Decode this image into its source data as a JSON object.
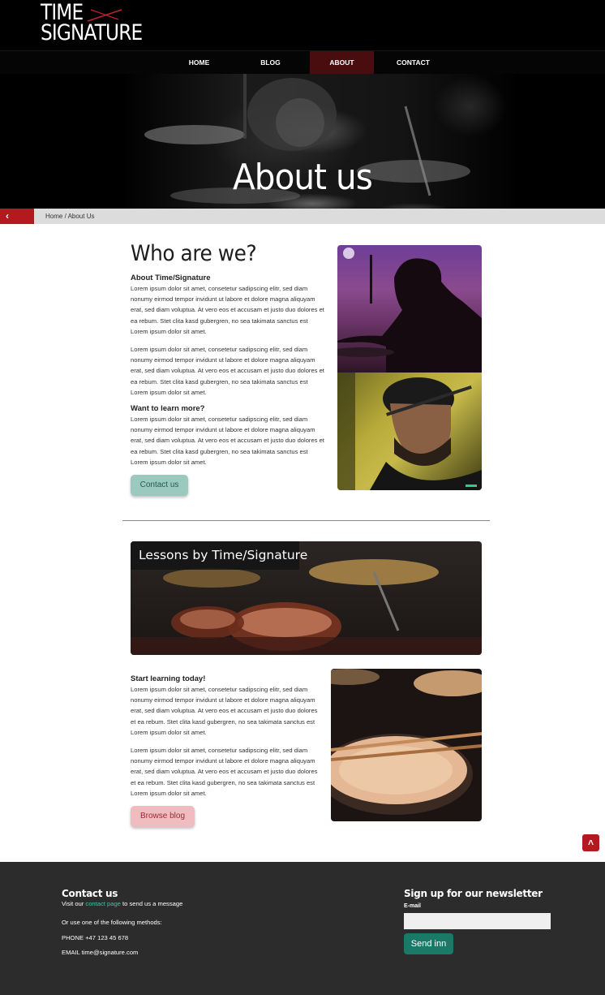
{
  "brand": {
    "line1": "TIME",
    "line2": "SIGNATURE"
  },
  "nav": [
    {
      "label": "HOME"
    },
    {
      "label": "BLOG"
    },
    {
      "label": "ABOUT"
    },
    {
      "label": "CONTACT"
    }
  ],
  "nav_active": "ABOUT",
  "hero": {
    "title": "About us"
  },
  "breadcrumb": {
    "back_icon": "chevron-left-icon",
    "text": "Home / About Us"
  },
  "who": {
    "title": "Who are we?",
    "about_heading": "About Time/Signature",
    "para1": "Lorem ipsum dolor sit amet, consetetur sadipscing elitr, sed diam nonumy eirmod tempor invidunt ut labore et dolore magna aliquyam erat, sed diam voluptua. At vero eos et accusam et justo duo dolores et ea rebum. Stet clita kasd gubergren, no sea takimata sanctus est Lorem ipsum dolor sit amet.",
    "para2": "Lorem ipsum dolor sit amet, consetetur sadipscing elitr, sed diam nonumy eirmod tempor invidunt ut labore et dolore magna aliquyam erat, sed diam voluptua. At vero eos et accusam et justo duo dolores et ea rebum. Stet clita kasd gubergren, no sea takimata sanctus est Lorem ipsum dolor sit amet.",
    "learn_heading": "Want to learn more?",
    "para3": "Lorem ipsum dolor sit amet, consetetur sadipscing elitr, sed diam nonumy eirmod tempor invidunt ut labore et dolore magna aliquyam erat, sed diam voluptua. At vero eos et accusam et justo duo dolores et ea rebum. Stet clita kasd gubergren, no sea takimata sanctus est Lorem ipsum dolor sit amet.",
    "contact_button": "Contact us"
  },
  "lessons": {
    "banner_title": "Lessons by Time/Signature",
    "start_heading": "Start learning today!",
    "para1": "Lorem ipsum dolor sit amet, consetetur sadipscing elitr, sed diam nonumy eirmod tempor invidunt ut labore et dolore magna aliquyam erat, sed diam voluptua. At vero eos et accusam et justo duo dolores et ea rebum. Stet clita kasd gubergren, no sea takimata sanctus est Lorem ipsum dolor sit amet.",
    "para2": "Lorem ipsum dolor sit amet, consetetur sadipscing elitr, sed diam nonumy eirmod tempor invidunt ut labore et dolore magna aliquyam erat, sed diam voluptua. At vero eos et accusam et justo duo dolores et ea rebum. Stet clita kasd gubergren, no sea takimata sanctus est Lorem ipsum dolor sit amet.",
    "blog_button": "Browse blog"
  },
  "scroll_top_icon": "chevron-up-icon",
  "footer": {
    "contact_title": "Contact us",
    "visit_prefix": "Visit our ",
    "visit_link": "contact page",
    "visit_suffix": " to send us a message",
    "methods": "Or use one of the following methods:",
    "phone": "PHONE +47 123 45 678",
    "email": "EMAIL time@signature.com",
    "newsletter_title": "Sign up for our newsletter",
    "email_label": "E-mail",
    "email_value": "",
    "signup_button": "Send inn"
  },
  "colors": {
    "accent_red": "#b3191f",
    "nav_active_bg": "#4a0d0f",
    "green_button": "#9cc9bd",
    "pink_button": "#f0bcc0",
    "footer_bg": "#2c2c2c",
    "footer_link": "#3fc3a8",
    "signup_button": "#1a7a67"
  }
}
